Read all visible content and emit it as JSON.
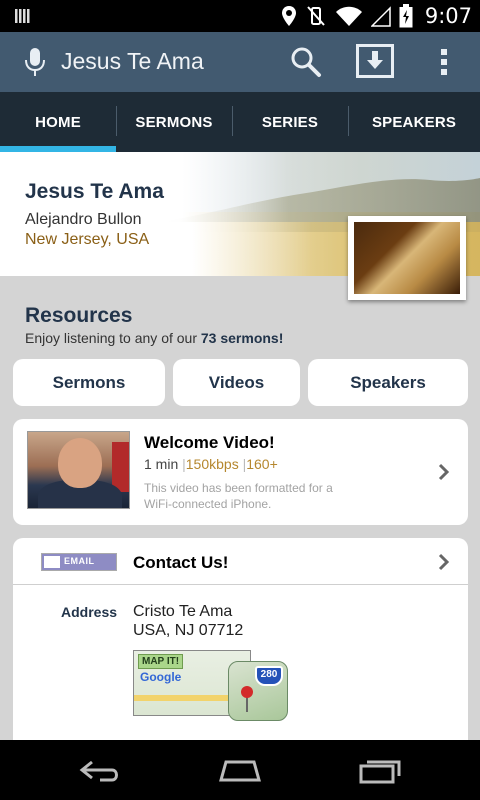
{
  "status_bar": {
    "time": "9:07",
    "icons": [
      "notification-icon",
      "location-icon",
      "vibrate-off-icon",
      "wifi-icon",
      "signal-icon",
      "battery-icon"
    ]
  },
  "action_bar": {
    "title": "Jesus Te Ama",
    "icons": [
      "mic-icon",
      "search-icon",
      "download-icon",
      "overflow-menu-icon"
    ]
  },
  "tabs": [
    {
      "label": "HOME",
      "active": true
    },
    {
      "label": "SERMONS",
      "active": false
    },
    {
      "label": "SERIES",
      "active": false
    },
    {
      "label": "SPEAKERS",
      "active": false
    }
  ],
  "header": {
    "title": "Jesus Te Ama",
    "name": "Alejandro Bullon",
    "location": "New Jersey, USA"
  },
  "resources": {
    "title": "Resources",
    "subtitle_prefix": "Enjoy listening to any of our ",
    "subtitle_bold": "73 sermons!",
    "buttons": [
      "Sermons",
      "Videos",
      "Speakers"
    ]
  },
  "video": {
    "title": "Welcome Video!",
    "duration": "1 min",
    "sep1": "|",
    "bitrate": "150kbps",
    "sep2": "|",
    "resolution": "160+",
    "description": "This video has been formatted for a WiFi-connected iPhone."
  },
  "contact": {
    "badge": "EMAIL",
    "title": "Contact Us!",
    "address_label": "Address",
    "address_line1": "Cristo Te Ama",
    "address_line2": "USA, NJ 07712",
    "map_label": "MAP IT!",
    "map_brand": "Google",
    "route_number": "280"
  },
  "colors": {
    "action_bar": "#425a70",
    "tab_bar": "#1e2b36",
    "tab_indicator": "#33b5e5",
    "heading": "#22344a",
    "location": "#8a5f16"
  }
}
